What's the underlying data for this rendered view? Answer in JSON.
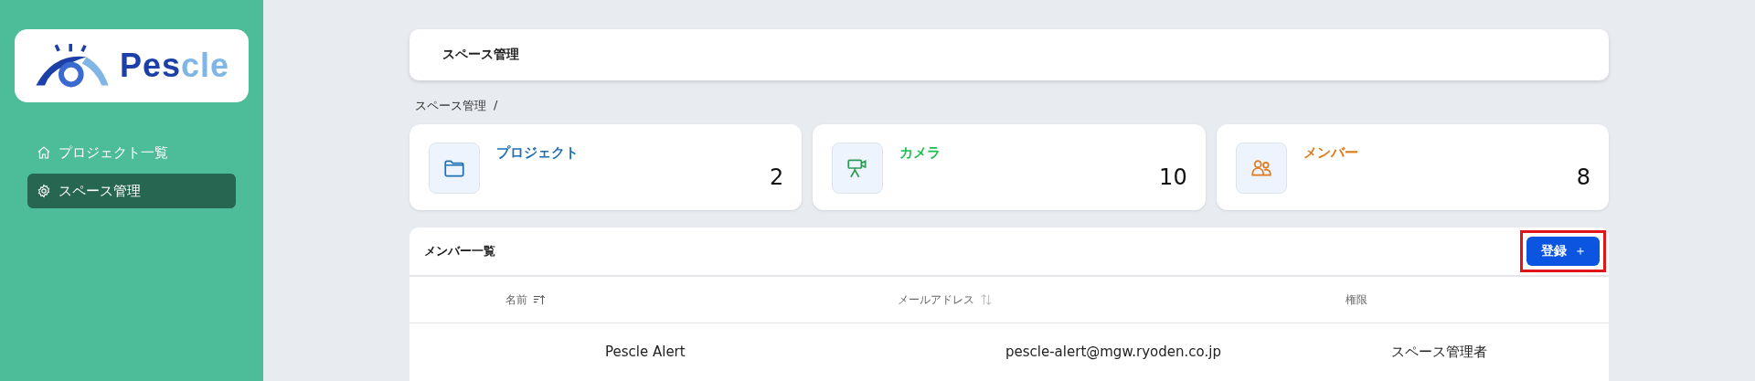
{
  "logo": {
    "text_dark": "Pes",
    "text_light": "cle"
  },
  "sidebar": {
    "items": [
      {
        "label": "プロジェクト一覧",
        "kind": "home",
        "selected": false
      },
      {
        "label": "スペース管理",
        "kind": "settings",
        "selected": true
      }
    ]
  },
  "header": {
    "title": "スペース管理"
  },
  "breadcrumb": [
    "スペース管理",
    "/"
  ],
  "stats": [
    {
      "label": "プロジェクト",
      "value": "2",
      "kind": "project",
      "color": "#1f6fb5"
    },
    {
      "label": "カメラ",
      "value": "10",
      "kind": "camera",
      "color": "#1fbf4f"
    },
    {
      "label": "メンバー",
      "value": "8",
      "kind": "member",
      "color": "#e07a1a"
    }
  ],
  "members": {
    "title": "メンバー一覧",
    "register_button": {
      "label": "登録",
      "icon": "＋",
      "highlighted": true
    },
    "columns": [
      {
        "label": "名前",
        "kind": "sorted"
      },
      {
        "label": "メールアドレス",
        "kind": "sortable"
      },
      {
        "label": "権限",
        "kind": "plain"
      }
    ],
    "rows": [
      [
        "Pescle Alert",
        "pescle-alert@mgw.ryoden.co.jp",
        "スペース管理者"
      ]
    ]
  }
}
